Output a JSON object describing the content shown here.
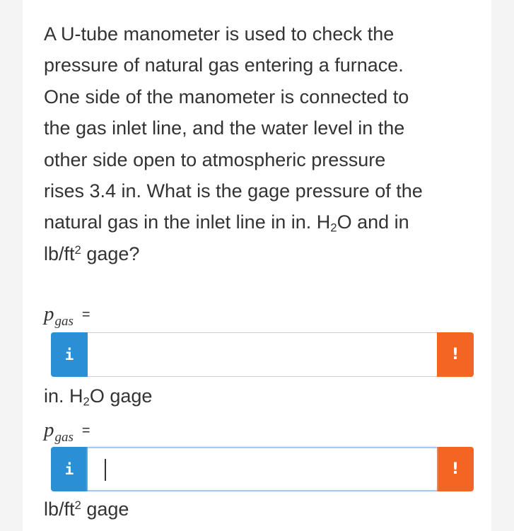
{
  "question": {
    "line_1": "A U-tube manometer is used to check the",
    "line_2": "pressure of natural gas entering a furnace.",
    "line_3": "One side of the manometer is connected to",
    "line_4": "the gas inlet line, and the water level in the",
    "line_5": "other side open to atmospheric pressure",
    "line_6": "rises 3.4 in. What is the gage pressure of the",
    "line_7_a": "natural gas in the inlet line in in. H",
    "line_7_sub": "2",
    "line_7_b": "O and in",
    "line_8_a": "lb/ft",
    "line_8_sup": "2",
    "line_8_b": " gage?"
  },
  "answer_1": {
    "var_symbol": "p",
    "var_subscript": "gas",
    "equals": "=",
    "info_icon_glyph": "i",
    "value": "",
    "alert_icon_glyph": "!",
    "unit_a": "in. H",
    "unit_sub": "2",
    "unit_b": "O gage"
  },
  "answer_2": {
    "var_symbol": "p",
    "var_subscript": "gas",
    "equals": "=",
    "info_icon_glyph": "i",
    "value": "",
    "alert_icon_glyph": "!",
    "unit_a": "lb/ft",
    "unit_sup": "2",
    "unit_b": " gage"
  },
  "colors": {
    "info_button": "#2b8fd6",
    "alert_button": "#f26522",
    "focus_border": "#a9c9ef",
    "text": "#333333",
    "background": "#f4f4f4"
  },
  "icons": {
    "info": "info-icon",
    "alert": "alert-icon"
  }
}
